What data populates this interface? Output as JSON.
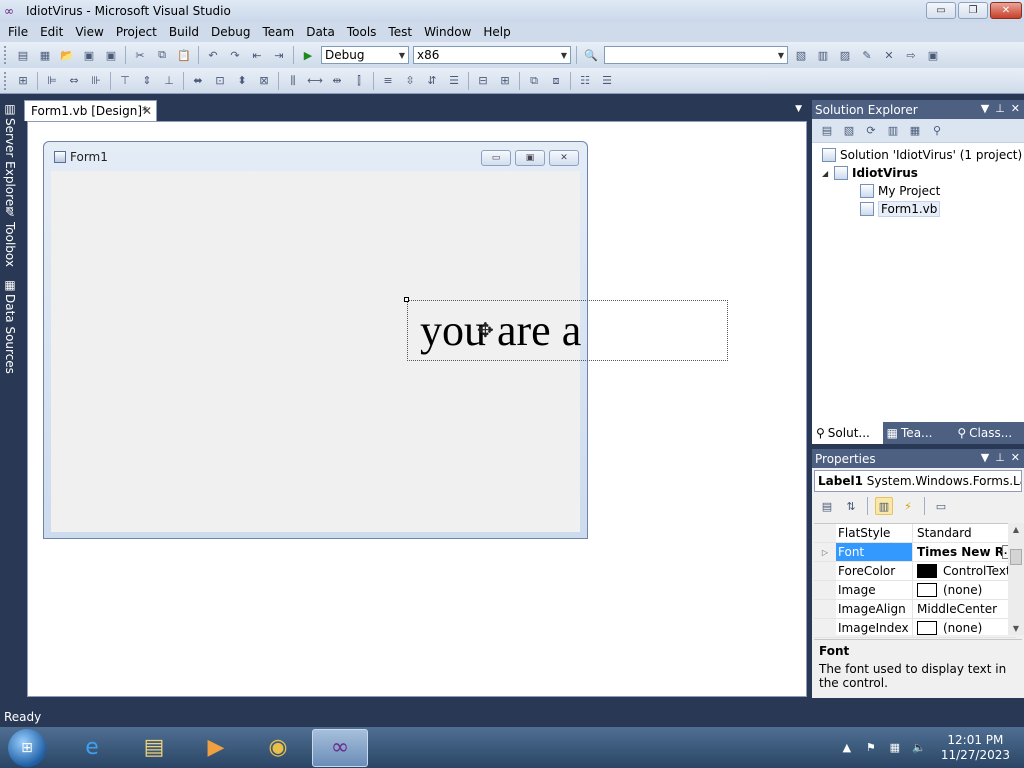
{
  "window": {
    "title": "IdiotVirus - Microsoft Visual Studio",
    "minimize": "▭",
    "restore": "❐",
    "close": "✕"
  },
  "menu": [
    "File",
    "Edit",
    "View",
    "Project",
    "Build",
    "Debug",
    "Team",
    "Data",
    "Tools",
    "Test",
    "Window",
    "Help"
  ],
  "toolbar": {
    "config": "Debug",
    "platform": "x86",
    "find_value": ""
  },
  "side_tabs": [
    "Server Explorer",
    "Toolbox",
    "Data Sources"
  ],
  "doc_tab": {
    "label": "Form1.vb [Design]*",
    "close": "✕"
  },
  "form": {
    "title": "Form1",
    "label_text": "you are a"
  },
  "solution_explorer": {
    "title": "Solution Explorer",
    "items": [
      {
        "label": "Solution 'IdiotVirus' (1 project)"
      },
      {
        "label": "IdiotVirus"
      },
      {
        "label": "My Project"
      },
      {
        "label": "Form1.vb"
      }
    ],
    "tabs": [
      "Solut...",
      "Tea...",
      "Class..."
    ]
  },
  "properties": {
    "title": "Properties",
    "object_name": "Label1",
    "object_type": "System.Windows.Forms.La",
    "rows": [
      {
        "name": "FlatStyle",
        "value": "Standard"
      },
      {
        "name": "Font",
        "value": "Times New R",
        "button": "..."
      },
      {
        "name": "ForeColor",
        "value": "ControlText",
        "swatch": "#000000"
      },
      {
        "name": "Image",
        "value": "(none)",
        "swatch": "#ffffff"
      },
      {
        "name": "ImageAlign",
        "value": "MiddleCenter"
      },
      {
        "name": "ImageIndex",
        "value": "(none)",
        "swatch": "#ffffff"
      }
    ],
    "desc_title": "Font",
    "desc_text": "The font used to display text in the control."
  },
  "status": {
    "text": "Ready"
  },
  "taskbar": {
    "time": "12:01 PM",
    "date": "11/27/2023"
  },
  "colors": {
    "ide_dark": "#293955",
    "pane_header": "#4d6082",
    "selection": "#3399ff"
  }
}
